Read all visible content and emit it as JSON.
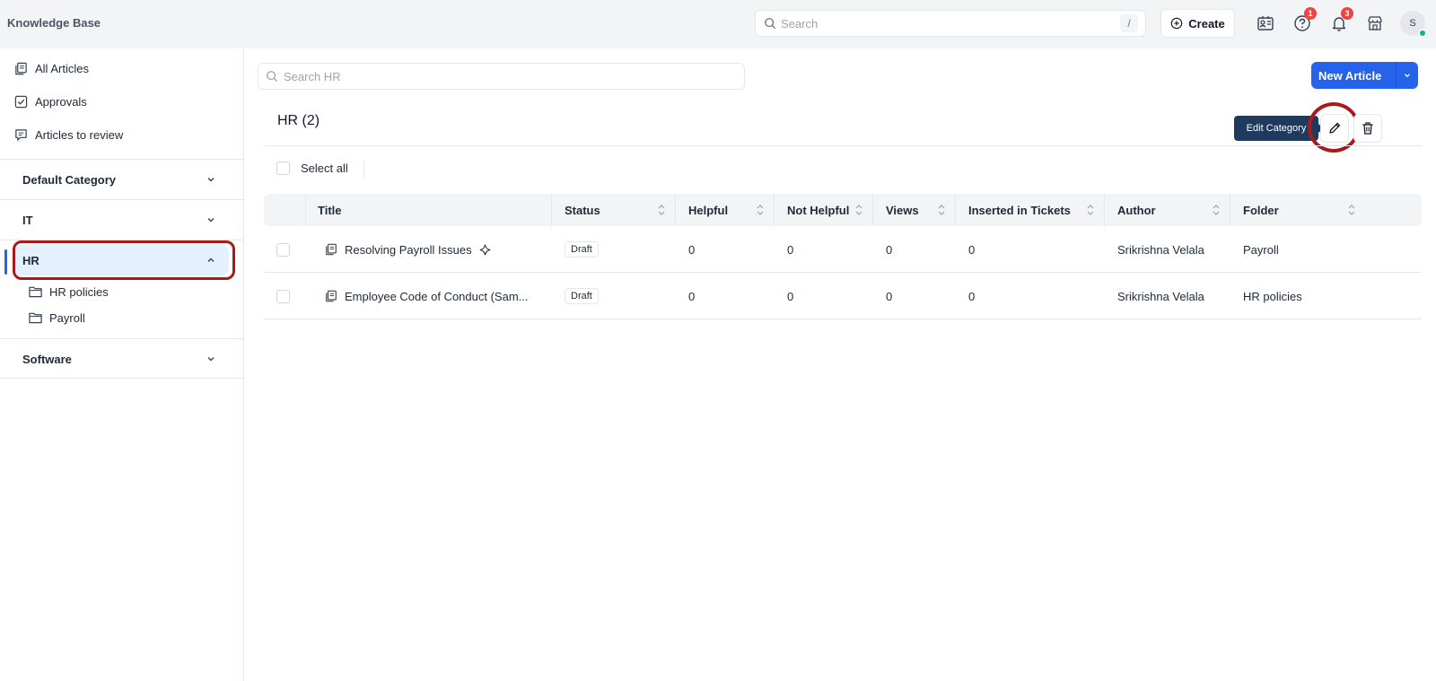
{
  "app": {
    "title": "Knowledge Base"
  },
  "topbar": {
    "search_placeholder": "Search",
    "search_shortcut": "/",
    "create_label": "Create",
    "help_badge": "1",
    "notifications_badge": "3",
    "avatar_initial": "S"
  },
  "sidebar": {
    "nav": [
      {
        "label": "All Articles",
        "icon": "articles-icon"
      },
      {
        "label": "Approvals",
        "icon": "checkbox-icon"
      },
      {
        "label": "Articles to review",
        "icon": "review-icon"
      }
    ],
    "categories": [
      {
        "label": "Default Category",
        "expanded": false
      },
      {
        "label": "IT",
        "expanded": false
      },
      {
        "label": "HR",
        "expanded": true,
        "selected": true
      },
      {
        "label": "Software",
        "expanded": false
      }
    ],
    "hr_folders": [
      "HR policies",
      "Payroll"
    ]
  },
  "main": {
    "search_placeholder": "Search HR",
    "new_article_label": "New Article",
    "page_title": "HR (2)",
    "tooltip": "Edit Category",
    "select_all_label": "Select all",
    "columns": [
      "Title",
      "Status",
      "Helpful",
      "Not Helpful",
      "Views",
      "Inserted in Tickets",
      "Author",
      "Folder"
    ],
    "rows": [
      {
        "title": "Resolving Payroll Issues",
        "status": "Draft",
        "helpful": "0",
        "not_helpful": "0",
        "views": "0",
        "inserted": "0",
        "author": "Srikrishna Velala",
        "folder": "Payroll"
      },
      {
        "title": "Employee Code of Conduct (Sam...",
        "status": "Draft",
        "helpful": "0",
        "not_helpful": "0",
        "views": "0",
        "inserted": "0",
        "author": "Srikrishna Velala",
        "folder": "HR policies"
      }
    ]
  },
  "colors": {
    "accent": "#2563eb",
    "highlight": "#a61b1b",
    "selected_bg": "#e3f0fd",
    "tooltip_bg": "#1f3a5f"
  }
}
